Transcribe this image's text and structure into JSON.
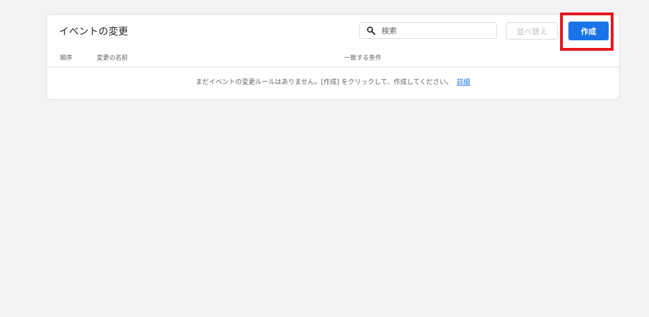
{
  "card": {
    "title": "イベントの変更"
  },
  "search": {
    "placeholder": "検索",
    "value": ""
  },
  "toolbar": {
    "reorder_label": "並べ替え",
    "create_label": "作成"
  },
  "table": {
    "columns": [
      "順序",
      "変更の名前",
      "一致する条件"
    ],
    "empty_message": "まだイベントの変更ルールはありません。[作成] をクリックして、作成してください。",
    "details_link": "詳細"
  },
  "colors": {
    "accent": "#1a73e8",
    "highlight": "#e8141c",
    "background": "#f1f3f4"
  },
  "icons": {
    "search": "search-icon"
  }
}
